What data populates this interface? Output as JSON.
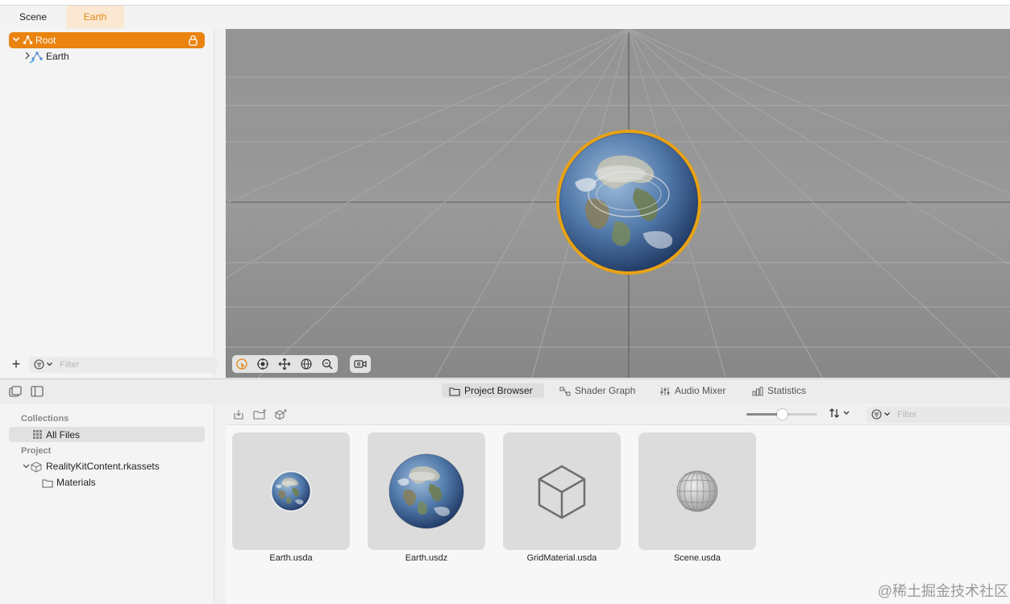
{
  "tabs": [
    {
      "label": "Scene",
      "active": false
    },
    {
      "label": "Earth",
      "active": true
    }
  ],
  "colors": {
    "accent": "#ea8310",
    "active_tab_text": "#e58a1a",
    "selection_ring": "#e8a215"
  },
  "outline": {
    "items": [
      {
        "label": "Root",
        "icon": "entity-icon",
        "expanded": true,
        "selected": true,
        "locked": true
      },
      {
        "label": "Earth",
        "icon": "model-entity-icon",
        "expanded": false,
        "selected": false
      }
    ],
    "filter_placeholder": "Filter"
  },
  "viewport": {
    "tools": [
      "select-tool-icon",
      "orbit-tool-icon",
      "move-tool-icon",
      "rotate-tool-icon",
      "zoom-tool-icon",
      "camera-icon"
    ]
  },
  "bottom_tabs": [
    {
      "label": "Project Browser",
      "icon": "folder-icon",
      "active": true
    },
    {
      "label": "Shader Graph",
      "icon": "shader-graph-icon",
      "active": false
    },
    {
      "label": "Audio Mixer",
      "icon": "audio-mixer-icon",
      "active": false
    },
    {
      "label": "Statistics",
      "icon": "statistics-icon",
      "active": false
    }
  ],
  "browser": {
    "collections_header": "Collections",
    "all_files_label": "All Files",
    "project_header": "Project",
    "package_label": "RealityKitContent.rkassets",
    "materials_label": "Materials",
    "filter_placeholder": "Filter",
    "thumbnail_zoom": 0.5,
    "assets": [
      {
        "name": "Earth.usda",
        "thumb": "small-earth"
      },
      {
        "name": "Earth.usdz",
        "thumb": "large-earth"
      },
      {
        "name": "GridMaterial.usda",
        "thumb": "cube-outline"
      },
      {
        "name": "Scene.usda",
        "thumb": "grid-sphere"
      }
    ]
  },
  "watermark": "@稀土掘金技术社区"
}
